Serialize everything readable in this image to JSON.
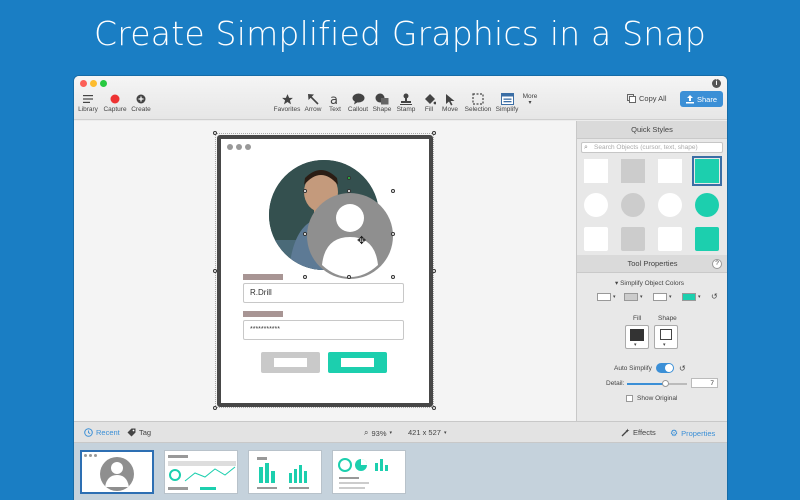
{
  "headline": "Create Simplified Graphics in a Snap",
  "toolbar": {
    "left": [
      {
        "label": "Library",
        "icon": "list-icon"
      },
      {
        "label": "Capture",
        "icon": "record-icon"
      },
      {
        "label": "Create",
        "icon": "plus-circle-icon"
      }
    ],
    "tools": [
      {
        "label": "Favorites",
        "icon": "star-icon"
      },
      {
        "label": "Arrow",
        "icon": "arrow-icon"
      },
      {
        "label": "Text",
        "icon": "text-icon"
      },
      {
        "label": "Callout",
        "icon": "callout-icon"
      },
      {
        "label": "Shape",
        "icon": "shape-icon"
      },
      {
        "label": "Stamp",
        "icon": "stamp-icon"
      },
      {
        "label": "Fill",
        "icon": "bucket-icon"
      },
      {
        "label": "Move",
        "icon": "cursor-icon"
      },
      {
        "label": "Selection",
        "icon": "selection-icon"
      },
      {
        "label": "Simplify",
        "icon": "simplify-icon"
      },
      {
        "label": "More",
        "icon": "chevron-down-icon"
      }
    ],
    "copy_all": "Copy All",
    "share": "Share",
    "info": "i"
  },
  "canvas": {
    "name_value": "R.Drill",
    "password_value": "***********"
  },
  "quick_styles": {
    "title": "Quick Styles",
    "search_placeholder": "Search Objects (cursor, text, shape)",
    "colors": {
      "white": "#ffffff",
      "gray": "#cccccc",
      "teal": "#1ccfae"
    }
  },
  "tool_properties": {
    "title": "Tool Properties",
    "help": "?",
    "simplify_colors_label": "Simplify Object Colors",
    "fill_label": "Fill",
    "shape_label": "Shape",
    "auto_simplify_label": "Auto Simplify",
    "detail_label": "Detail:",
    "detail_value": "7",
    "show_original_label": "Show Original"
  },
  "bottom_bar": {
    "recent": "Recent",
    "tag": "Tag",
    "zoom": "93% ",
    "zoom_caret": "▾",
    "dimensions": "421 x 527 ",
    "dim_caret": "▾",
    "effects": "Effects",
    "properties": "Properties"
  },
  "colors": {
    "background": "#1a7ec4",
    "accent_blue": "#3b8fd6",
    "teal": "#1ccfae",
    "device_frame": "#474747"
  }
}
